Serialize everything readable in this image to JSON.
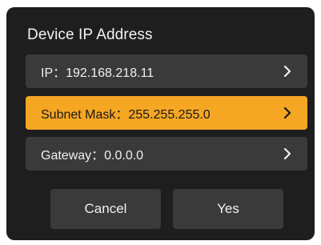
{
  "dialog": {
    "title": "Device IP Address",
    "rows": [
      {
        "label": "IP：192.168.218.11",
        "selected": false,
        "icon": "chevron-right-icon"
      },
      {
        "label": "Subnet Mask：255.255.255.0",
        "selected": true,
        "icon": "chevron-right-icon"
      },
      {
        "label": "Gateway：0.0.0.0",
        "selected": false,
        "icon": "chevron-right-icon"
      }
    ],
    "buttons": {
      "cancel_label": "Cancel",
      "yes_label": "Yes"
    }
  },
  "colors": {
    "dialog_background": "#1e1e1e",
    "row_background": "#3a3a3a",
    "selected_accent": "#f5a623",
    "text": "#f0f0f0"
  }
}
